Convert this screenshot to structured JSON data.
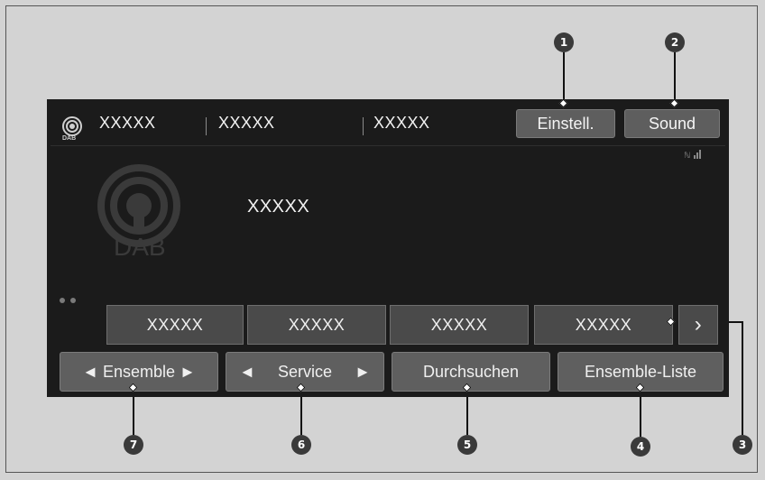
{
  "header": {
    "station_1": "XXXXX",
    "station_2": "XXXXX",
    "station_3": "XXXXX",
    "settings_button": "Einstell.",
    "sound_button": "Sound"
  },
  "main": {
    "logo_text": "DAB",
    "badge_text": "DAB",
    "now_playing": "XXXXX"
  },
  "presets": [
    "XXXXX",
    "XXXXX",
    "XXXXX",
    "XXXXX"
  ],
  "preset_next": "›",
  "bottom_bar": {
    "ensemble": "◄ Ensemble ►",
    "service_prev": "◄",
    "service": "Service",
    "service_next": "►",
    "search": "Durchsuchen",
    "ensemble_list": "Ensemble-Liste"
  },
  "callouts": [
    "1",
    "2",
    "3",
    "4",
    "5",
    "6",
    "7"
  ]
}
